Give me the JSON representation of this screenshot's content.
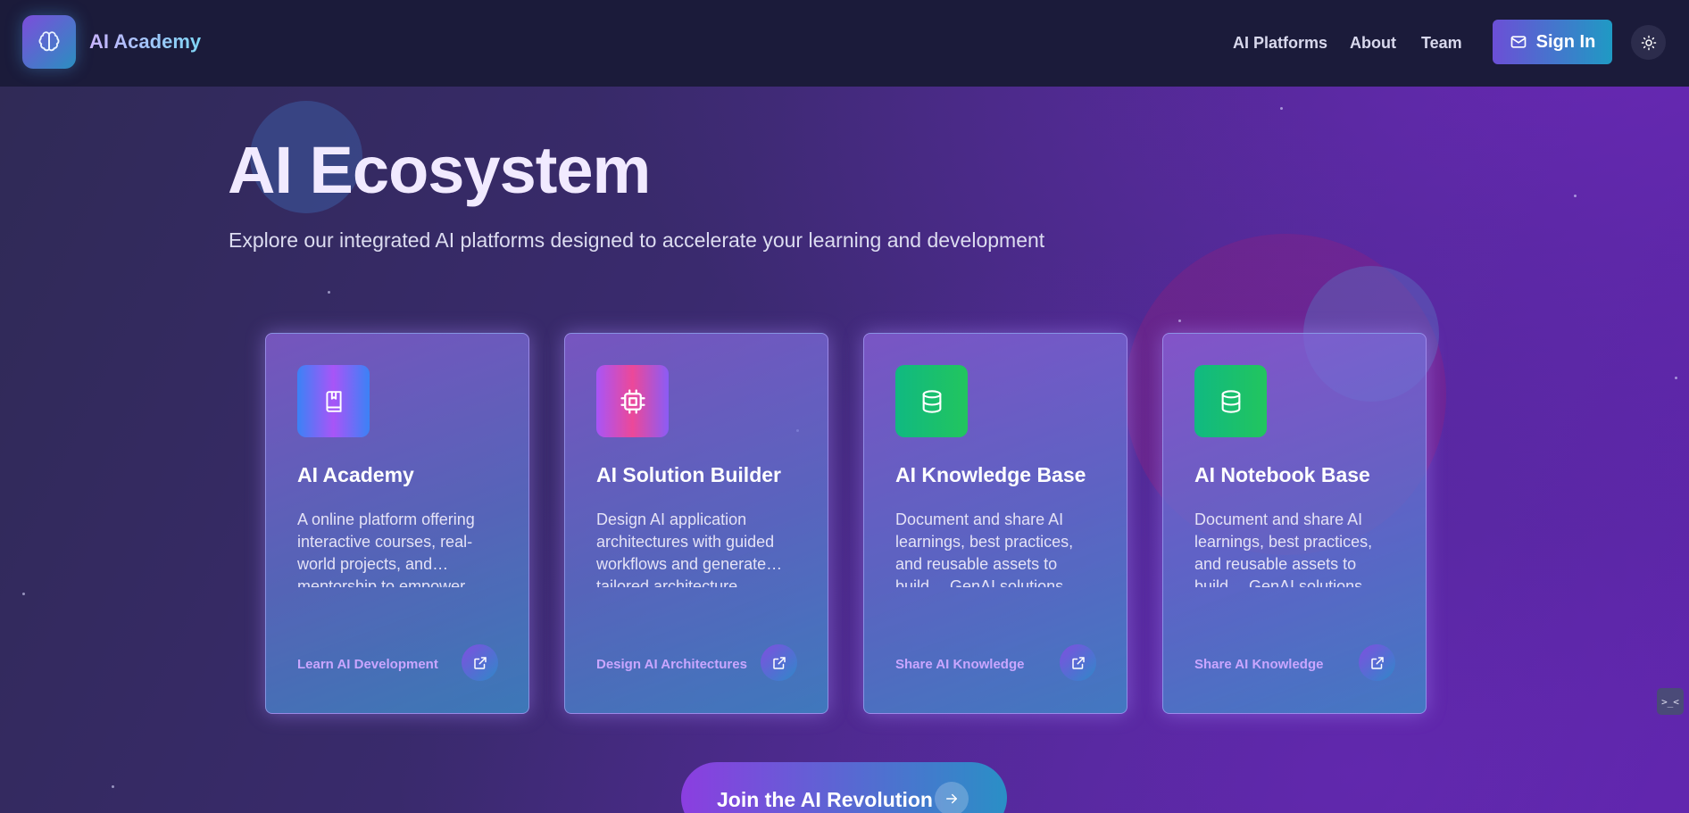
{
  "header": {
    "brand": "AI Academy",
    "logo_icon": "brain-icon",
    "nav": [
      {
        "label": "AI Platforms"
      },
      {
        "label": "About"
      },
      {
        "label": "Team"
      }
    ],
    "sign_in_label": "Sign In",
    "sign_in_icon": "mail-icon",
    "theme_icon": "sun-icon"
  },
  "hero": {
    "title": "AI Ecosystem",
    "subtitle": "Explore our integrated AI platforms designed to accelerate your learning and development"
  },
  "cards": [
    {
      "title": "AI Academy",
      "description": "A online platform offering interactive courses, real-world projects, and… mentorship to empower developers in harnessing",
      "link": "Learn AI Development",
      "icon": "book-icon",
      "icon_gradient": [
        "#3b82f6",
        "#a855f7",
        "#3b82f6"
      ]
    },
    {
      "title": "AI Solution Builder",
      "description": "Design AI application architectures with guided workflows and generate… tailored architecture diagrams to serve as a",
      "link": "Design AI Architectures",
      "icon": "cpu-icon",
      "icon_gradient": [
        "#a855f7",
        "#ec4899",
        "#8b5cf6"
      ]
    },
    {
      "title": "AI Knowledge Base",
      "description": "Document and share AI learnings, best practices, and reusable assets to build… GenAI solutions efficiently and collaboratively",
      "link": "Share AI Knowledge",
      "icon": "database-icon",
      "icon_gradient": [
        "#10b981",
        "#22c55e"
      ]
    },
    {
      "title": "AI Notebook Base",
      "description": "Document and share AI learnings, best practices, and reusable assets to build… GenAI solutions efficiently and collaboratively",
      "link": "Share AI Knowledge",
      "icon": "database-icon",
      "icon_gradient": [
        "#10b981",
        "#22c55e"
      ]
    }
  ],
  "card_action_icon": "external-link-icon",
  "cta": {
    "label": "Join the AI Revolution",
    "icon": "arrow-right-icon"
  },
  "side_widget": {
    "label": ">_<"
  }
}
